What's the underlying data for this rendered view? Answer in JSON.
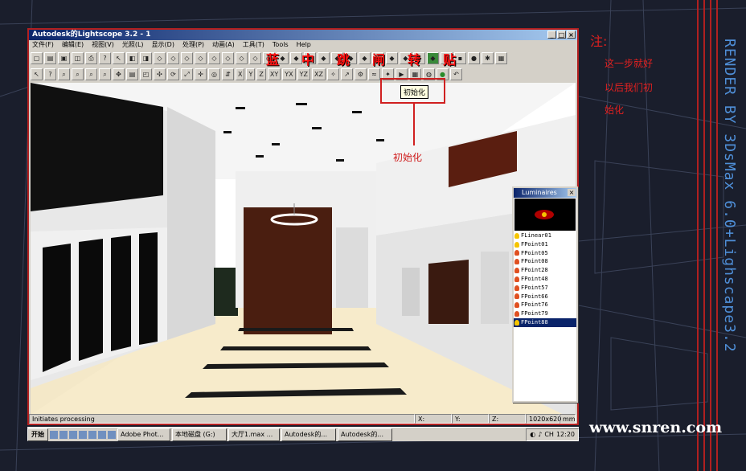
{
  "window": {
    "title": "Autodesk的Lightscope 3.2 - 1",
    "controls": [
      "_",
      "□",
      "×"
    ]
  },
  "menu": [
    "文件(F)",
    "编辑(E)",
    "视图(V)",
    "光照(L)",
    "显示(D)",
    "处理(P)",
    "动画(A)",
    "工具(T)",
    "Tools",
    "Help"
  ],
  "toolbar_row1": [
    "new",
    "open",
    "save",
    "close",
    "print",
    "help",
    "whats-this",
    "layer",
    "select",
    "cube1",
    "cube2",
    "cube3",
    "cube4",
    "cube5",
    "cube6",
    "cube7",
    "cube8",
    "render"
  ],
  "toolbar_row2": [
    "arrow",
    "query",
    "zoom",
    "zoom-extent",
    "zoom-window",
    "zoom-prev",
    "pan",
    "layers",
    "camera",
    "move",
    "rotate",
    "scale",
    "pivot"
  ],
  "axis_buttons": [
    "X",
    "Y",
    "Z",
    "XY",
    "YX",
    "YZ",
    "XZ"
  ],
  "overlay_chars": [
    "蓝",
    "中",
    "跳",
    "闸",
    "转",
    "贴"
  ],
  "tooltip": "初始化",
  "annotation_label": "初始化",
  "luminaires": {
    "title": "Luminaires",
    "close": "×",
    "items": [
      {
        "name": "FLinear01",
        "icon": "yellow-bulb"
      },
      {
        "name": "FPoint01",
        "icon": "yellow-bulb"
      },
      {
        "name": "FPoint05",
        "icon": "red-bulb"
      },
      {
        "name": "FPoint08",
        "icon": "red-bulb"
      },
      {
        "name": "FPoint28",
        "icon": "red-bulb"
      },
      {
        "name": "FPoint48",
        "icon": "red-bulb"
      },
      {
        "name": "FPoint57",
        "icon": "red-bulb"
      },
      {
        "name": "FPoint66",
        "icon": "red-bulb"
      },
      {
        "name": "FPoint76",
        "icon": "red-bulb"
      },
      {
        "name": "FPoint79",
        "icon": "red-bulb"
      },
      {
        "name": "FPoint88",
        "icon": "yellow-bulb",
        "selected": true
      }
    ]
  },
  "status": {
    "message": "Initiates processing",
    "x": "X:",
    "y": "Y:",
    "z": "Z:",
    "size": "1020x620",
    "units": "mm"
  },
  "taskbar": {
    "start": "开始",
    "tasks": [
      "Adobe Phot...",
      "本地磁盘 (G:)",
      "大厅1.max ...",
      "Autodesk的...",
      "Autodesk的..."
    ],
    "clock": "12:20",
    "ime": "CH"
  },
  "notes": {
    "title": "注:",
    "lines": [
      "这一步就好",
      "以后我们初",
      "始化"
    ]
  },
  "credit": "RENDER BY 3DsMax 6.0+Lighscape3.2",
  "site": "www.snren.com",
  "colors": {
    "annotation_red": "#e02020",
    "credit_blue": "#4f8fd8",
    "title_blue": "#0a246a"
  }
}
